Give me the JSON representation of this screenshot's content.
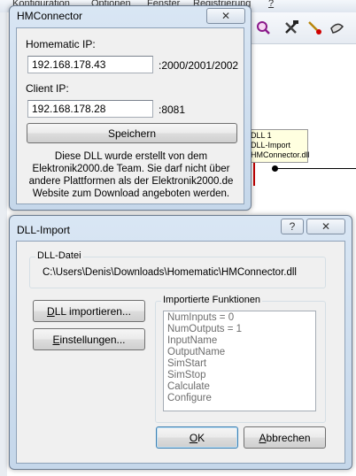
{
  "background": {
    "menu": [
      "Konfiguration",
      "Optionen",
      "Fenster",
      "Registrierung",
      "?"
    ],
    "block": {
      "lines": [
        "DLL 1",
        "DLL-Import",
        "HMConnector.dll"
      ]
    },
    "toolbar_icons": [
      "magnifier-icon",
      "tools-icon",
      "brush-icon",
      "pen-icon"
    ]
  },
  "hmconnector": {
    "title": "HMConnector",
    "homematic_ip_label": "Homematic IP:",
    "homematic_ip_value": "192.168.178.43",
    "homematic_ports": ":2000/2001/2002",
    "client_ip_label": "Client IP:",
    "client_ip_value": "192.168.178.28",
    "client_port": ":8081",
    "save_label": "Speichern",
    "info_lines": [
      "Diese DLL wurde erstellt von dem",
      "Elektronik2000.de Team. Sie darf nicht über",
      "andere Plattformen als der Elektronik2000.de",
      "Website zum Download angeboten werden."
    ],
    "close_glyph": "✕"
  },
  "dll_import": {
    "title": "DLL-Import",
    "help_glyph": "?",
    "close_glyph": "✕",
    "file_group_label": "DLL-Datei",
    "file_path": "C:\\Users\\Denis\\Downloads\\Homematic\\HMConnector.dll",
    "import_button": {
      "accel": "D",
      "rest": "LL importieren..."
    },
    "settings_button": {
      "accel": "E",
      "rest": "instellungen..."
    },
    "functions_group_label": "Importierte Funktionen",
    "functions": [
      "NumInputs = 0",
      "NumOutputs = 1",
      "InputName",
      "OutputName",
      "SimStart",
      "SimStop",
      "Calculate",
      "Configure"
    ],
    "ok_button": {
      "accel": "O",
      "rest": "K"
    },
    "cancel_button": {
      "accel": "A",
      "rest": "bbrechen"
    }
  }
}
